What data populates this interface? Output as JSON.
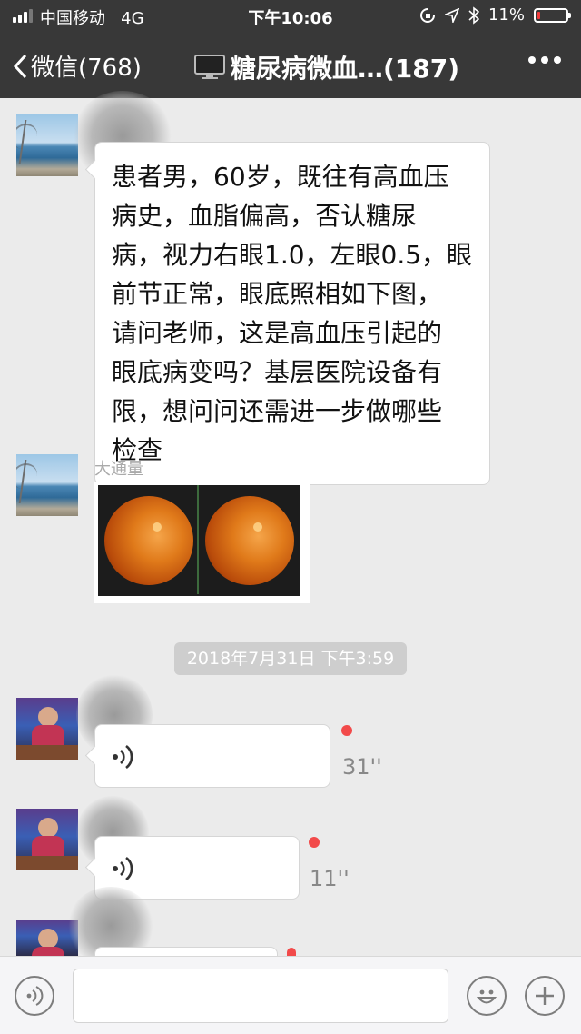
{
  "status_bar": {
    "carrier": "中国移动",
    "network": "4G",
    "time": "下午10:06",
    "battery_text": "11%",
    "battery_level": 0.11
  },
  "nav": {
    "back_label": "微信(768)",
    "title": "糖尿病微血…(187)"
  },
  "messages": {
    "m1": {
      "text": "患者男，60岁，既往有高血压\n病史，血脂偏高，否认糖尿\n病，视力右眼1.0，左眼0.5，眼\n前节正常，眼底照相如下图，\n请问老师，这是高血压引起的\n眼底病变吗？基层医院设备有\n限，想问问还需进一步做哪些\n检查"
    },
    "m2": {
      "sender": "大通量"
    },
    "time_divider": "2018年7月31日 下午3:59",
    "voice1": {
      "duration": "31''"
    },
    "voice2": {
      "duration": "11''"
    }
  },
  "colors": {
    "header_bg": "#383838",
    "chat_bg": "#ebebeb",
    "unread_dot": "#f24a4a",
    "battery_low": "#f23b3b"
  }
}
